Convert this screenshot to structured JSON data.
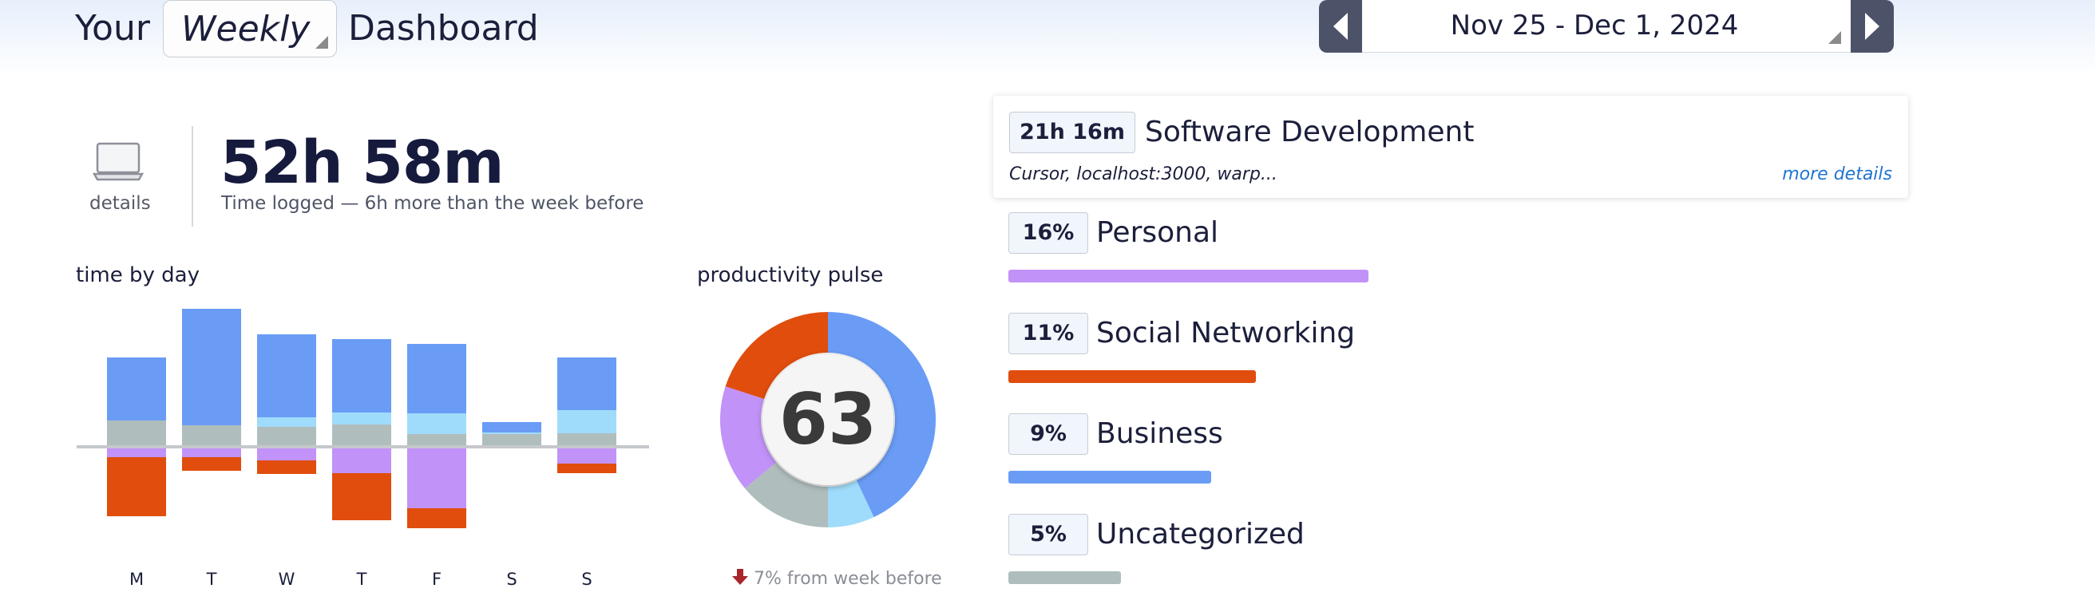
{
  "header": {
    "prefix": "Your",
    "period": "Weekly",
    "suffix": "Dashboard",
    "date_range": "Nov 25 - Dec 1, 2024"
  },
  "summary": {
    "icon": "laptop-icon",
    "details_label": "details",
    "total_time": "52h 58m",
    "subtitle": "Time logged — 6h more than the week before"
  },
  "time_by_day": {
    "title": "time by day",
    "chart_data": {
      "type": "bar",
      "categories": [
        "M",
        "T",
        "W",
        "T",
        "F",
        "S",
        "S"
      ],
      "stacked": true,
      "diverging": true,
      "series": [
        {
          "color": "#6a9cf6",
          "values": [
            7.9,
            14.6,
            10.4,
            9.2,
            8.7,
            1.3,
            6.6
          ]
        },
        {
          "color": "#9fdcfb",
          "values": [
            0,
            0,
            1.2,
            1.5,
            2.6,
            0.2,
            2.9
          ]
        },
        {
          "color": "#b0bdbd",
          "values": [
            3.3,
            2.7,
            2.5,
            2.8,
            1.6,
            1.6,
            1.7
          ]
        },
        {
          "color": "#c192f7",
          "values": [
            -1.3,
            -1.3,
            -1.7,
            -3.3,
            -7.7,
            0,
            -2.1
          ]
        },
        {
          "color": "#e04d0d",
          "values": [
            -7.4,
            -1.7,
            -1.7,
            -5.9,
            -2.5,
            0,
            -1.2
          ]
        }
      ]
    }
  },
  "pulse": {
    "title": "productivity pulse",
    "score": "63",
    "change": "7% from week before",
    "chart_data": {
      "type": "pie",
      "donut": true,
      "slices": [
        {
          "color": "#6a9cf6",
          "value": 43
        },
        {
          "color": "#9fdcfb",
          "value": 7
        },
        {
          "color": "#b0bdbd",
          "value": 14
        },
        {
          "color": "#c192f7",
          "value": 16
        },
        {
          "color": "#e04d0d",
          "value": 20
        }
      ]
    }
  },
  "categories": {
    "top": {
      "time": "21h 16m",
      "name": "Software Development",
      "apps": "Cursor, localhost:3000, warp...",
      "more": "more details"
    },
    "items": [
      {
        "pct": "16%",
        "name": "Personal",
        "color": "#c192f7",
        "value": 16
      },
      {
        "pct": "11%",
        "name": "Social Networking",
        "color": "#e04d0d",
        "value": 11
      },
      {
        "pct": "9%",
        "name": "Business",
        "color": "#6a9cf6",
        "value": 9
      },
      {
        "pct": "5%",
        "name": "Uncategorized",
        "color": "#b0bdbd",
        "value": 5
      }
    ]
  }
}
